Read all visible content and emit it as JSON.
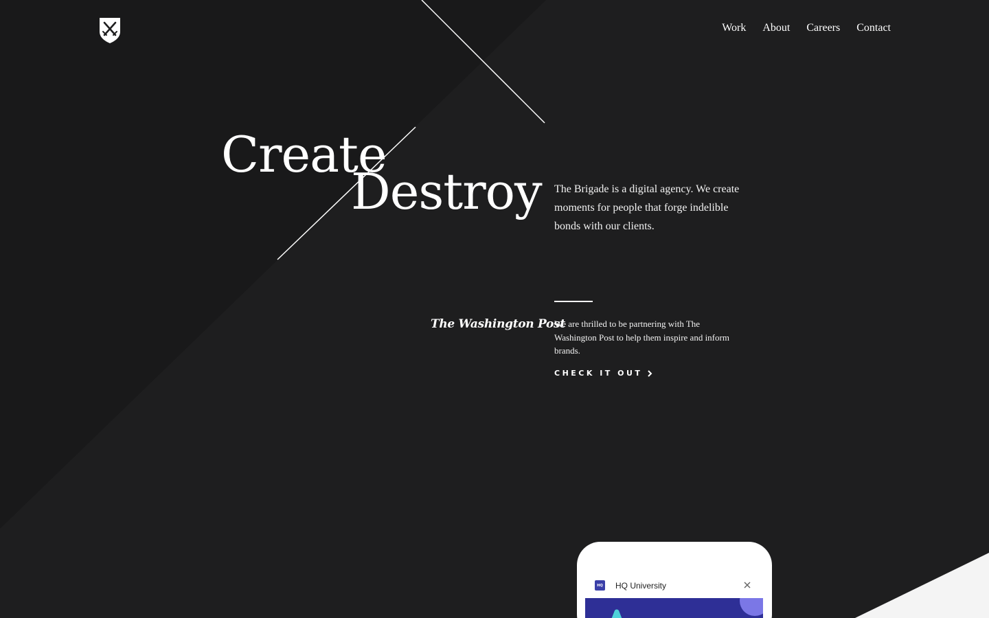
{
  "brand": {
    "logo_icon": "crossed-swords-shield-icon"
  },
  "nav": {
    "items": [
      {
        "label": "Work"
      },
      {
        "label": "About"
      },
      {
        "label": "Careers"
      },
      {
        "label": "Contact"
      }
    ]
  },
  "hero": {
    "line1": "Create",
    "line2": "Destroy",
    "intro": "The Brigade is a digital agency. We create moments for people that forge indelible bonds with our clients."
  },
  "partner": {
    "logo_text": "The Washington Post",
    "text": "We are thrilled to be partnering with The Washington Post to help them inspire and inform brands.",
    "cta_label": "CHECK IT OUT",
    "cta_icon": "chevron-right-icon"
  },
  "preview": {
    "app_icon_text": "HQ",
    "app_name": "HQ University",
    "close_icon": "close-icon"
  },
  "colors": {
    "background": "#1e1e1f",
    "diagonal_panel": "#1a1a1b",
    "accent_light": "#f4f4f4",
    "app_blue": "#2e2f96"
  }
}
